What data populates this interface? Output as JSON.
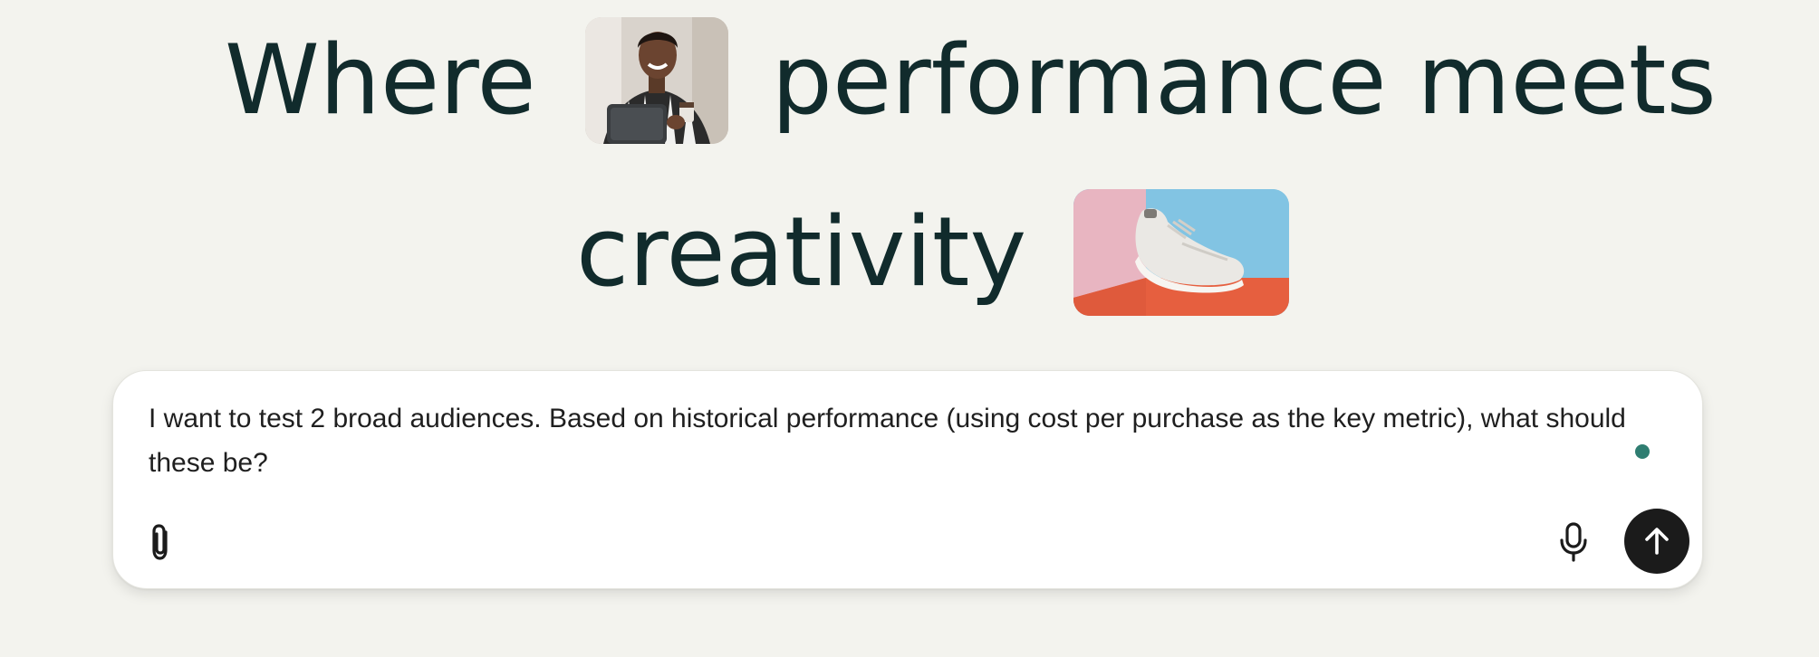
{
  "headline": {
    "line1_word1": "Where",
    "line1_word2": "performance meets",
    "line2_word1": "creativity",
    "images": [
      {
        "icon": "woman-with-laptop-photo"
      },
      {
        "icon": "sneaker-photo"
      }
    ]
  },
  "composer": {
    "text": "I want to test 2 broad audiences. Based on historical performance (using cost per purchase as the key metric), what should these be?",
    "status_color": "#2f7d71",
    "attach_icon": "paperclip-icon",
    "mic_icon": "microphone-icon",
    "send_icon": "arrow-up-icon",
    "send_bg": "#1b1b1b"
  }
}
